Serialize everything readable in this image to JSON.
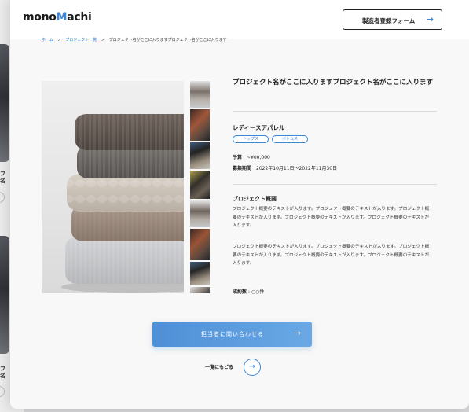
{
  "header": {
    "logo_prefix": "mono",
    "logo_m": "M",
    "logo_suffix": "achi",
    "register_button": "製造者登録フォーム",
    "register_arrow": "→"
  },
  "breadcrumb": {
    "home": "ホーム",
    "list": "プロジェクト一覧",
    "current": "プロジェクト名がここに入りますプロジェクト名がここに入ります",
    "separator": ">"
  },
  "background_page": {
    "snippet1": "プ\n名",
    "snippet2": "プ\n名"
  },
  "project": {
    "title": "プロジェクト名がここに入りますプロジェクト名がここに入ります",
    "company": "レディースアパレル",
    "tags": [
      "トップス",
      "ボトムス"
    ],
    "budget_label": "予算",
    "budget_value": "~¥00,000",
    "period_label": "募集期間",
    "period_value": "2022年10月11日～2022年11月30日",
    "overview_heading": "プロジェクト概要",
    "overview_p1": "プロジェクト概要のテキストが入ります。プロジェクト概要のテキストが入ります。プロジェクト概要のテキストが入ります。プロジェクト概要のテキストが入ります。プロジェクト概要のテキストが入ります。",
    "overview_p2": "プロジェクト概要のテキストが入ります。プロジェクト概要のテキストが入ります。プロジェクト概要のテキストが入ります。プロジェクト概要のテキストが入ります。プロジェクト概要のテキストが入ります。",
    "deals_label": "成約数",
    "deals_value": "○○件"
  },
  "actions": {
    "contact_button": "担当者に問い合わせる",
    "contact_arrow": "→",
    "back_label": "一覧にもどる",
    "back_arrow": "→"
  },
  "colors": {
    "accent": "#3a86d8"
  },
  "media": {
    "main_image": "folded-sweaters-photo",
    "thumbnail_count": 11
  }
}
